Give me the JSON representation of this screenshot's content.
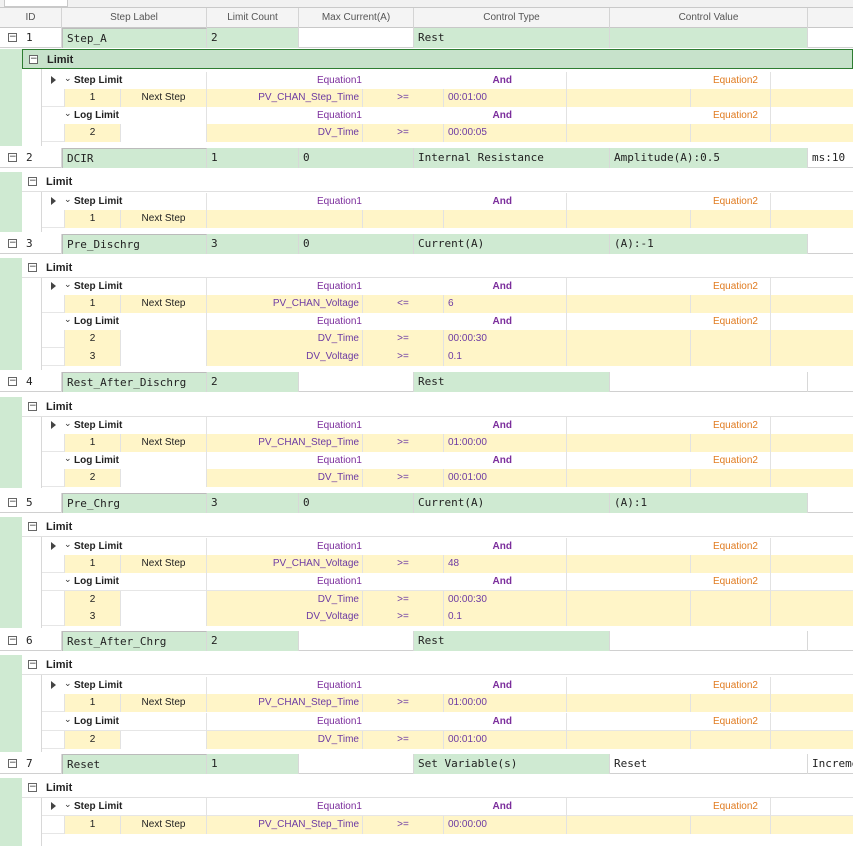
{
  "columns": [
    "ID",
    "Step Label",
    "Limit Count",
    "Max Current(A)",
    "Control Type",
    "Control Value"
  ],
  "limit_title": "Limit",
  "step_limit_label": "Step Limit",
  "log_limit_label": "Log Limit",
  "equation1": "Equation1",
  "and_label": "And",
  "equation2": "Equation2",
  "next_step": "Next Step",
  "steps": [
    {
      "id": "1",
      "label": "Step_A",
      "limit_count": "2",
      "max_current": "",
      "control_type": "Rest",
      "control_value": "",
      "extra": "",
      "step_limits": [
        {
          "n": "1",
          "goto": "Next Step",
          "var": "PV_CHAN_Step_Time",
          "op": ">=",
          "val": "00:01:00"
        }
      ],
      "log_limits": [
        {
          "n": "2",
          "goto": "",
          "var": "DV_Time",
          "op": ">=",
          "val": "00:00:05"
        }
      ]
    },
    {
      "id": "2",
      "label": "DCIR",
      "limit_count": "1",
      "max_current": "0",
      "control_type": "Internal Resistance",
      "control_value": "Amplitude(A):0.5",
      "extra": "ms:10",
      "step_limits": [
        {
          "n": "1",
          "goto": "Next Step",
          "var": "",
          "op": "",
          "val": ""
        }
      ],
      "log_limits": []
    },
    {
      "id": "3",
      "label": "Pre_Dischrg",
      "limit_count": "3",
      "max_current": "0",
      "control_type": "Current(A)",
      "control_value": "(A):-1",
      "extra": "",
      "step_limits": [
        {
          "n": "1",
          "goto": "Next Step",
          "var": "PV_CHAN_Voltage",
          "op": "<=",
          "val": "6"
        }
      ],
      "log_limits": [
        {
          "n": "2",
          "goto": "",
          "var": "DV_Time",
          "op": ">=",
          "val": "00:00:30"
        },
        {
          "n": "3",
          "goto": "",
          "var": "DV_Voltage",
          "op": ">=",
          "val": "0.1"
        }
      ]
    },
    {
      "id": "4",
      "label": "Rest_After_Dischrg",
      "limit_count": "2",
      "max_current": "",
      "control_type": "Rest",
      "control_value": "",
      "extra": "",
      "step_limits": [
        {
          "n": "1",
          "goto": "Next Step",
          "var": "PV_CHAN_Step_Time",
          "op": ">=",
          "val": "01:00:00"
        }
      ],
      "log_limits": [
        {
          "n": "2",
          "goto": "",
          "var": "DV_Time",
          "op": ">=",
          "val": "00:01:00"
        }
      ]
    },
    {
      "id": "5",
      "label": "Pre_Chrg",
      "limit_count": "3",
      "max_current": "0",
      "control_type": "Current(A)",
      "control_value": "(A):1",
      "extra": "",
      "step_limits": [
        {
          "n": "1",
          "goto": "Next Step",
          "var": "PV_CHAN_Voltage",
          "op": ">=",
          "val": "48"
        }
      ],
      "log_limits": [
        {
          "n": "2",
          "goto": "",
          "var": "DV_Time",
          "op": ">=",
          "val": "00:00:30"
        },
        {
          "n": "3",
          "goto": "",
          "var": "DV_Voltage",
          "op": ">=",
          "val": "0.1"
        }
      ]
    },
    {
      "id": "6",
      "label": "Rest_After_Chrg",
      "limit_count": "2",
      "max_current": "",
      "control_type": "Rest",
      "control_value": "",
      "extra": "",
      "step_limits": [
        {
          "n": "1",
          "goto": "Next Step",
          "var": "PV_CHAN_Step_Time",
          "op": ">=",
          "val": "01:00:00"
        }
      ],
      "log_limits": [
        {
          "n": "2",
          "goto": "",
          "var": "DV_Time",
          "op": ">=",
          "val": "00:01:00"
        }
      ]
    },
    {
      "id": "7",
      "label": "Reset",
      "limit_count": "1",
      "max_current": "",
      "control_type": "Set Variable(s)",
      "control_value": "Reset",
      "extra": "Increme",
      "step_limits": [
        {
          "n": "1",
          "goto": "Next Step",
          "var": "PV_CHAN_Step_Time",
          "op": ">=",
          "val": "00:00:00"
        }
      ],
      "log_limits": []
    }
  ],
  "colors": {
    "step_green": "#cfead2",
    "limit_yellow": "#fff5c8",
    "equation_purple": "#7b2d9c",
    "equation2_orange": "#e07b20"
  }
}
